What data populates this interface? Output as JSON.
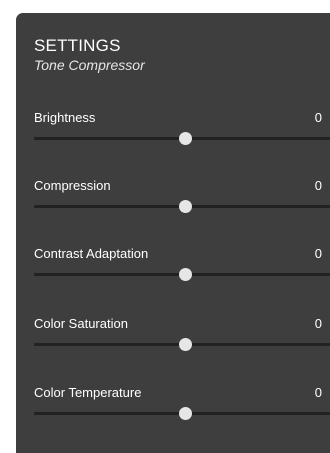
{
  "header": {
    "title": "SETTINGS",
    "subtitle": "Tone Compressor"
  },
  "sliders": [
    {
      "label": "Brightness",
      "value": "0",
      "level": 0.5
    },
    {
      "label": "Compression",
      "value": "0",
      "level": 0.5
    },
    {
      "label": "Contrast Adaptation",
      "value": "0",
      "level": 0.5
    },
    {
      "label": "Color Saturation",
      "value": "0",
      "level": 0.5
    },
    {
      "label": "Color Temperature",
      "value": "0",
      "level": 0.5
    }
  ]
}
